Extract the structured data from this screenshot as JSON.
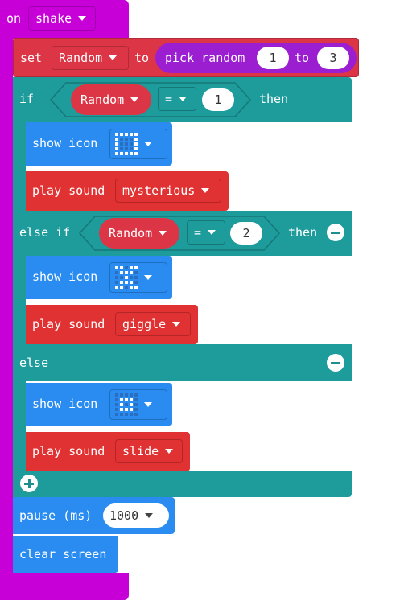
{
  "event": {
    "prefix": "on",
    "gesture": "shake"
  },
  "set_block": {
    "label": "set",
    "variable": "Random",
    "to_label": "to"
  },
  "pick_random": {
    "label": "pick random",
    "from": "1",
    "to_label": "to",
    "to": "3"
  },
  "if_block": {
    "if_label": "if",
    "then_label": "then",
    "else_if_label": "else if",
    "else_label": "else"
  },
  "cond1": {
    "variable": "Random",
    "operator": "=",
    "value": "1"
  },
  "cond2": {
    "variable": "Random",
    "operator": "=",
    "value": "2"
  },
  "branch1": {
    "show_label": "show icon",
    "play_label": "play sound",
    "sound": "mysterious"
  },
  "branch2": {
    "show_label": "show icon",
    "play_label": "play sound",
    "sound": "giggle"
  },
  "branch3": {
    "show_label": "show icon",
    "play_label": "play sound",
    "sound": "slide"
  },
  "icons": {
    "icon1": [
      1,
      1,
      1,
      1,
      1,
      1,
      0,
      0,
      0,
      1,
      1,
      0,
      0,
      0,
      1,
      1,
      0,
      0,
      0,
      1,
      1,
      1,
      1,
      1,
      1
    ],
    "icon2": [
      1,
      1,
      0,
      1,
      1,
      0,
      1,
      1,
      1,
      0,
      0,
      0,
      1,
      0,
      0,
      0,
      1,
      1,
      1,
      0,
      1,
      1,
      0,
      1,
      1
    ],
    "icon3": [
      0,
      0,
      0,
      0,
      0,
      0,
      1,
      1,
      1,
      0,
      0,
      1,
      0,
      1,
      0,
      0,
      1,
      1,
      1,
      0,
      0,
      0,
      0,
      0,
      0
    ]
  },
  "pause": {
    "label": "pause (ms)",
    "value": "1000"
  },
  "clear": {
    "label": "clear screen"
  },
  "colors": {
    "event": "#c800d8",
    "variables": "#dc3545",
    "math": "#9c1ed1",
    "logic": "#1e9b9b",
    "basic": "#2a8cf0",
    "music": "#e03232"
  }
}
